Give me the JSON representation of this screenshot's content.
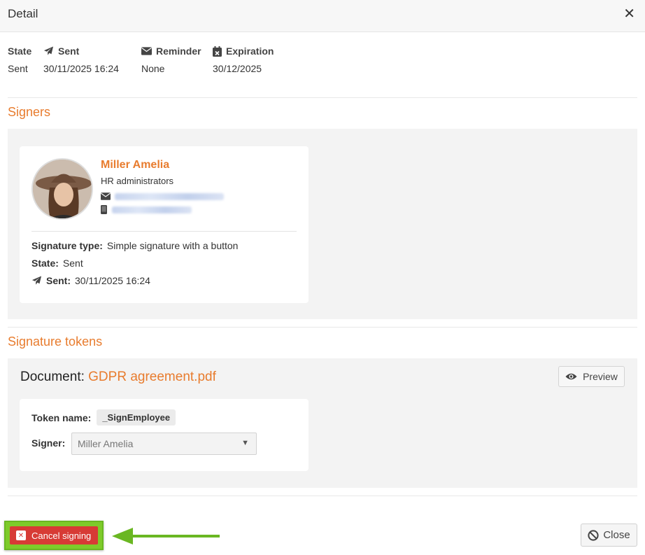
{
  "header": {
    "title": "Detail",
    "close_glyph": "✕"
  },
  "summary": {
    "state": {
      "label": "State",
      "value": "Sent"
    },
    "sent": {
      "label": "Sent",
      "value": "30/11/2025 16:24",
      "icon": "paper-plane-icon"
    },
    "reminder": {
      "label": "Reminder",
      "value": "None",
      "icon": "envelope-icon"
    },
    "expiration": {
      "label": "Expiration",
      "value": "30/12/2025",
      "icon": "calendar-x-icon"
    }
  },
  "signers": {
    "title": "Signers",
    "items": [
      {
        "name": "Miller Amelia",
        "role": "HR administrators",
        "signature_type_label": "Signature type:",
        "signature_type": "Simple signature with a button",
        "state_label": "State:",
        "state": "Sent",
        "sent_label": "Sent:",
        "sent": "30/11/2025 16:24"
      }
    ]
  },
  "tokens": {
    "title": "Signature tokens",
    "document_label": "Document:",
    "document_name": "GDPR agreement.pdf",
    "preview_label": "Preview",
    "token_name_label": "Token name:",
    "token_name": "_SignEmployee",
    "signer_label": "Signer:",
    "signer_value": "Miller Amelia"
  },
  "footer": {
    "cancel_label": "Cancel signing",
    "close_label": "Close"
  },
  "colors": {
    "accent": "#e87c2e",
    "danger": "#d73b35",
    "highlight": "#7ecb2a"
  }
}
